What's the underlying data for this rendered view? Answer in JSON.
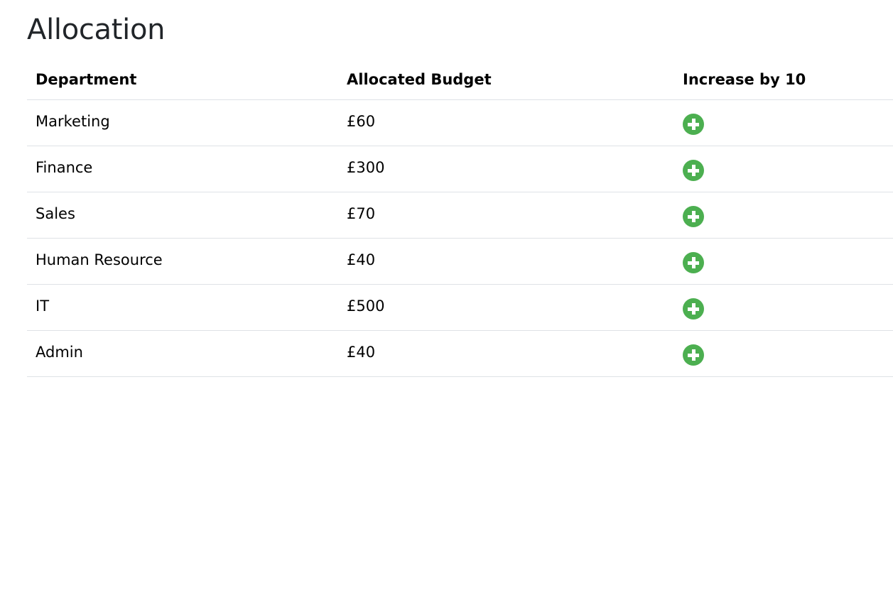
{
  "page": {
    "title": "Allocation"
  },
  "table": {
    "headers": {
      "department": "Department",
      "budget": "Allocated Budget",
      "increase": "Increase by 10"
    },
    "rows": [
      {
        "department": "Marketing",
        "budget": "£60",
        "action_icon": "plus-circle-icon"
      },
      {
        "department": "Finance",
        "budget": "£300",
        "action_icon": "plus-circle-icon"
      },
      {
        "department": "Sales",
        "budget": "£70",
        "action_icon": "plus-circle-icon"
      },
      {
        "department": "Human Resource",
        "budget": "£40",
        "action_icon": "plus-circle-icon"
      },
      {
        "department": "IT",
        "budget": "£500",
        "action_icon": "plus-circle-icon"
      },
      {
        "department": "Admin",
        "budget": "£40",
        "action_icon": "plus-circle-icon"
      }
    ]
  },
  "colors": {
    "plus_icon": "#4caf50",
    "row_border": "#dee2e6",
    "title": "#212529"
  }
}
